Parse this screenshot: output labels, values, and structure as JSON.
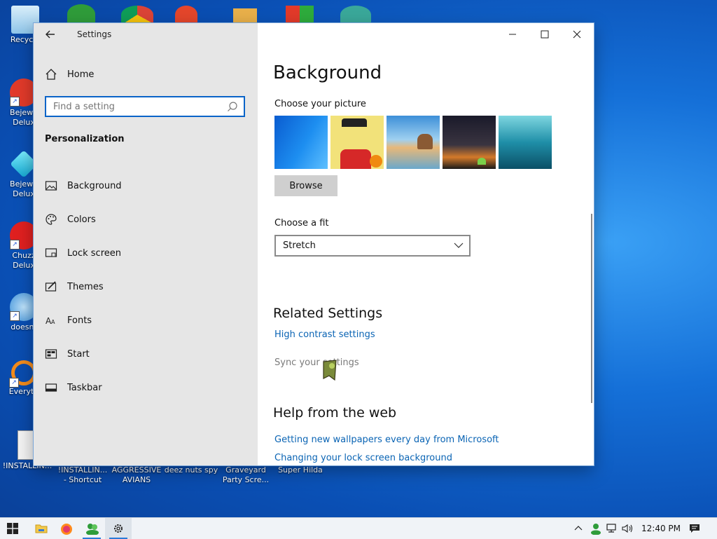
{
  "desktop": {
    "icons_left": [
      {
        "label": "Recycle",
        "color": "#9fd3f2"
      },
      {
        "label": "Bejewe",
        "label2": "Delux",
        "color": "#e23a2a"
      },
      {
        "label": "Bejewe",
        "label2": "Delux",
        "color": "#2ec9e6"
      },
      {
        "label": "Chuzz",
        "label2": "Delux",
        "color": "#e02020"
      },
      {
        "label": "doesnt",
        "color": "#63b2e8"
      },
      {
        "label": "Everyth",
        "color": "#f28b1c"
      }
    ],
    "icons_bottom": [
      {
        "label": "!INSTALLIN...",
        "label2": ""
      },
      {
        "label": "!INSTALLIN...",
        "label2": "- Shortcut"
      },
      {
        "label": "AGGRESSIVE",
        "label2": "AVIANS"
      },
      {
        "label": "deez nuts spy",
        "label2": ""
      },
      {
        "label": "Graveyard",
        "label2": "Party Scre..."
      },
      {
        "label": "Super Hilda",
        "label2": ""
      }
    ]
  },
  "window": {
    "title": "Settings",
    "sidebar": {
      "home_label": "Home",
      "search_placeholder": "Find a setting",
      "section": "Personalization",
      "items": [
        {
          "label": "Background",
          "icon": "picture-icon"
        },
        {
          "label": "Colors",
          "icon": "palette-icon"
        },
        {
          "label": "Lock screen",
          "icon": "lock-screen-icon"
        },
        {
          "label": "Themes",
          "icon": "themes-icon"
        },
        {
          "label": "Fonts",
          "icon": "fonts-icon"
        },
        {
          "label": "Start",
          "icon": "start-icon"
        },
        {
          "label": "Taskbar",
          "icon": "taskbar-icon"
        }
      ]
    },
    "content": {
      "title": "Background",
      "choose_picture": "Choose your picture",
      "browse_label": "Browse",
      "choose_fit": "Choose a fit",
      "fit_value": "Stretch",
      "related_heading": "Related Settings",
      "high_contrast_link": "High contrast settings",
      "sync_text": "Sync your settings",
      "help_heading": "Help from the web",
      "help_link_1": "Getting new wallpapers every day from Microsoft",
      "help_link_2": "Changing your lock screen background"
    }
  },
  "taskbar": {
    "clock": "12:40 PM"
  },
  "colors": {
    "accent": "#0a64b4",
    "sidebar_bg": "#e6e6e6",
    "desktop": "#1570d8"
  }
}
